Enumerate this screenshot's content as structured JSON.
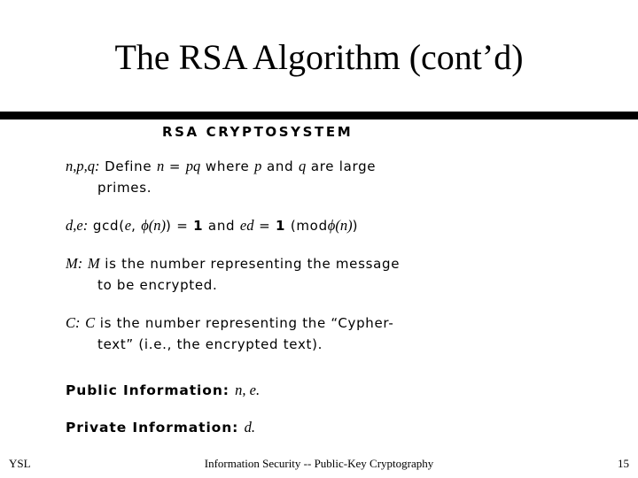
{
  "slide": {
    "title": "The RSA Algorithm (cont’d)",
    "divider_color": "#000000",
    "background_color": "#ffffff",
    "text_color": "#000000"
  },
  "content": {
    "heading": "RSA CRYPTOSYSTEM",
    "entries": [
      {
        "label": "n,p,q:",
        "line1_a": "Define",
        "var_n": "n",
        "eq": "=",
        "var_pq": "pq",
        "line1_b": "where",
        "var_p": "p",
        "line1_c": "and",
        "var_q": "q",
        "line1_d": "are large",
        "line2": "primes."
      },
      {
        "label": "d,e:",
        "text_a": "gcd(",
        "var_e": "e",
        "comma": ",",
        "phi_n_1": "ϕ(n)",
        "close": ")",
        "eq1": "=",
        "one1": "1",
        "and": "and",
        "var_ed": "ed",
        "eq2": "=",
        "one2": "1",
        "mod_open": "(",
        "mod": "mod",
        "phi_n_2": "ϕ(n)",
        "mod_close": ")"
      },
      {
        "label": "M:",
        "var": "M",
        "line1": "is the number representing the message",
        "line2": "to be encrypted."
      },
      {
        "label": "C:",
        "var": "C",
        "line1": "is the number representing the “Cypher-",
        "line2": "text” (i.e., the encrypted text)."
      }
    ],
    "public_information": {
      "label": "Public Information:",
      "value": "n, e."
    },
    "private_information": {
      "label": "Private Information:",
      "value": "d."
    }
  },
  "footer": {
    "left": "YSL",
    "center": "Information Security -- Public-Key Cryptography",
    "right": "15"
  }
}
